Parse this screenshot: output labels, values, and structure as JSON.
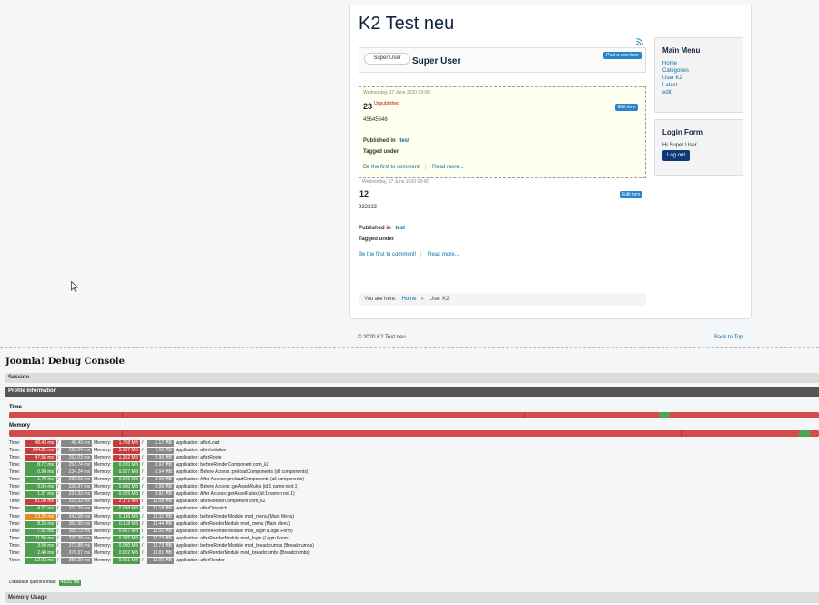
{
  "site": {
    "title": "K2 Test neu",
    "user_avatar_text": "Super User",
    "user_name": "Super User",
    "post_button": "Post a new item",
    "items": [
      {
        "date": "Wednesday, 17 June 2020 09:58",
        "title": "23",
        "status": "Unpublished",
        "text": "45645646",
        "published_in_label": "Published in",
        "category": "test",
        "tagged_label": "Tagged under",
        "comment_link": "Be the first to comment!",
        "read_more": "Read more...",
        "edit_button": "Edit item"
      },
      {
        "date": "Wednesday, 17 June 2020 09:42",
        "title": "12",
        "text": "232323",
        "published_in_label": "Published in",
        "category": "test",
        "tagged_label": "Tagged under",
        "comment_link": "Be the first to comment!",
        "read_more": "Read more...",
        "edit_button": "Edit item"
      }
    ],
    "breadcrumb": {
      "prefix": "You are here:",
      "home": "Home",
      "current": "User K2"
    },
    "main_menu": {
      "title": "Main Menu",
      "items": [
        "Home",
        "Categories",
        "User K2",
        "Latest",
        "edit"
      ]
    },
    "login_form": {
      "title": "Login Form",
      "greeting": "Hi Super User,",
      "logout": "Log out"
    },
    "footer": {
      "copyright": "© 2020 K2 Test neu",
      "back_to_top": "Back to Top"
    }
  },
  "debug": {
    "title": "Joomla! Debug Console",
    "session": "Session",
    "profile": "Profile Information",
    "time_label": "Time",
    "memory_label": "Memory",
    "colors": {
      "red": "#c33d3d",
      "green": "#4f9d4f",
      "orange": "#e08a20",
      "grey": "#888888"
    },
    "marks": [
      {
        "time": "48.43 ms",
        "time_total": "48.43 ms",
        "mem": "1.708 MB",
        "mem_total": "2.17 MB",
        "label": "Application: afterLoad",
        "tcolor": "red",
        "mcolor": "red"
      },
      {
        "time": "144.62 ms",
        "time_total": "193.04 ms",
        "mem": "5.367 MB",
        "mem_total": "7.53 MB",
        "label": "Application: afterInitialise",
        "tcolor": "red",
        "mcolor": "red"
      },
      {
        "time": "47.56 ms",
        "time_total": "253.03 ms",
        "mem": "1.352 MB",
        "mem_total": "8.90 MB",
        "label": "Application: afterRoute",
        "tcolor": "red",
        "mcolor": "red"
      },
      {
        "time": "8.72 ms",
        "time_total": "253.74 ms",
        "mem": "0.020 MB",
        "mem_total": "8.92 MB",
        "label": "Application: beforeRenderComponent com_k2",
        "tcolor": "green",
        "mcolor": "green"
      },
      {
        "time": "0.90 ms",
        "time_total": "234.24 ms",
        "mem": "0.027 MB",
        "mem_total": "8.94 MB",
        "label": "Application: Before Access::preloadComponents (all components)",
        "tcolor": "green",
        "mcolor": "green"
      },
      {
        "time": "1.70 ms",
        "time_total": "236.63 ms",
        "mem": "0.046 MB",
        "mem_total": "8.99 MB",
        "label": "Application: After Access::preloadComponents (all components)",
        "tcolor": "green",
        "mcolor": "green"
      },
      {
        "time": "0.04 ms",
        "time_total": "236.97 ms",
        "mem": "0.000 MB",
        "mem_total": "8.99 MB",
        "label": "Application: Before Access::getAssetRules (id:1 name:root.1)",
        "tcolor": "green",
        "mcolor": "green"
      },
      {
        "time": "1.37 ms",
        "time_total": "237.33 ms",
        "mem": "0.025 MB",
        "mem_total": "8.91 MB",
        "label": "Application: After Access::getAssetRules (id:1 name:root.1)",
        "tcolor": "green",
        "mcolor": "green"
      },
      {
        "time": "81.00 ms",
        "time_total": "318.33 ms",
        "mem": "2.172 MB",
        "mem_total": "11.08 MB",
        "label": "Application: afterRenderComponent com_k2",
        "tcolor": "red",
        "mcolor": "red"
      },
      {
        "time": "4.37 ms",
        "time_total": "323.39 ms",
        "mem": "0.098 MB",
        "mem_total": "11.18 MB",
        "label": "Application: afterDispatch",
        "tcolor": "green",
        "mcolor": "green"
      },
      {
        "time": "13.39 ms",
        "time_total": "342.58 ms",
        "mem": "0.136 MB",
        "mem_total": "11.32 MB",
        "label": "Application: beforeRenderModule mod_menu (Main Menu)",
        "tcolor": "orange",
        "mcolor": "green"
      },
      {
        "time": "8.33 ms",
        "time_total": "350.90 ms",
        "mem": "0.118 MB",
        "mem_total": "11.44 MB",
        "label": "Application: afterRenderModule mod_menu (Main Menu)",
        "tcolor": "green",
        "mcolor": "green"
      },
      {
        "time": "7.92 ms",
        "time_total": "358.73 ms",
        "mem": "0.067 MB",
        "mem_total": "11.50 MB",
        "label": "Application: beforeRenderModule mod_login (Login Form)",
        "tcolor": "green",
        "mcolor": "green"
      },
      {
        "time": "11.56 ms",
        "time_total": "370.38 ms",
        "mem": "0.205 MB",
        "mem_total": "11.73 MB",
        "label": "Application: afterRenderModule mod_login (Login Form)",
        "tcolor": "green",
        "mcolor": "green"
      },
      {
        "time": "3.50 ms",
        "time_total": "373.88 ms",
        "mem": "0.000 MB",
        "mem_total": "11.73 MB",
        "label": "Application: beforeRenderModule mod_breadcrumbs (Breadcrumbs)",
        "tcolor": "green",
        "mcolor": "green"
      },
      {
        "time": "2.48 ms",
        "time_total": "376.37 ms",
        "mem": "0.022 MB",
        "mem_total": "11.81 MB",
        "label": "Application: afterRenderModule mod_breadcrumbs (Breadcrumbs)",
        "tcolor": "green",
        "mcolor": "green"
      },
      {
        "time": "12.03 ms",
        "time_total": "388.39 ms",
        "mem": "0.051 MB",
        "mem_total": "11.90 MB",
        "label": "Application: afterRender",
        "tcolor": "green",
        "mcolor": "green"
      }
    ],
    "time_prefix": "Time:",
    "memory_prefix": "Memory:",
    "slash": "/",
    "db_queries_label": "Database queries total:",
    "db_queries_value": "45.01 ms",
    "memory_usage": "Memory Usage"
  }
}
